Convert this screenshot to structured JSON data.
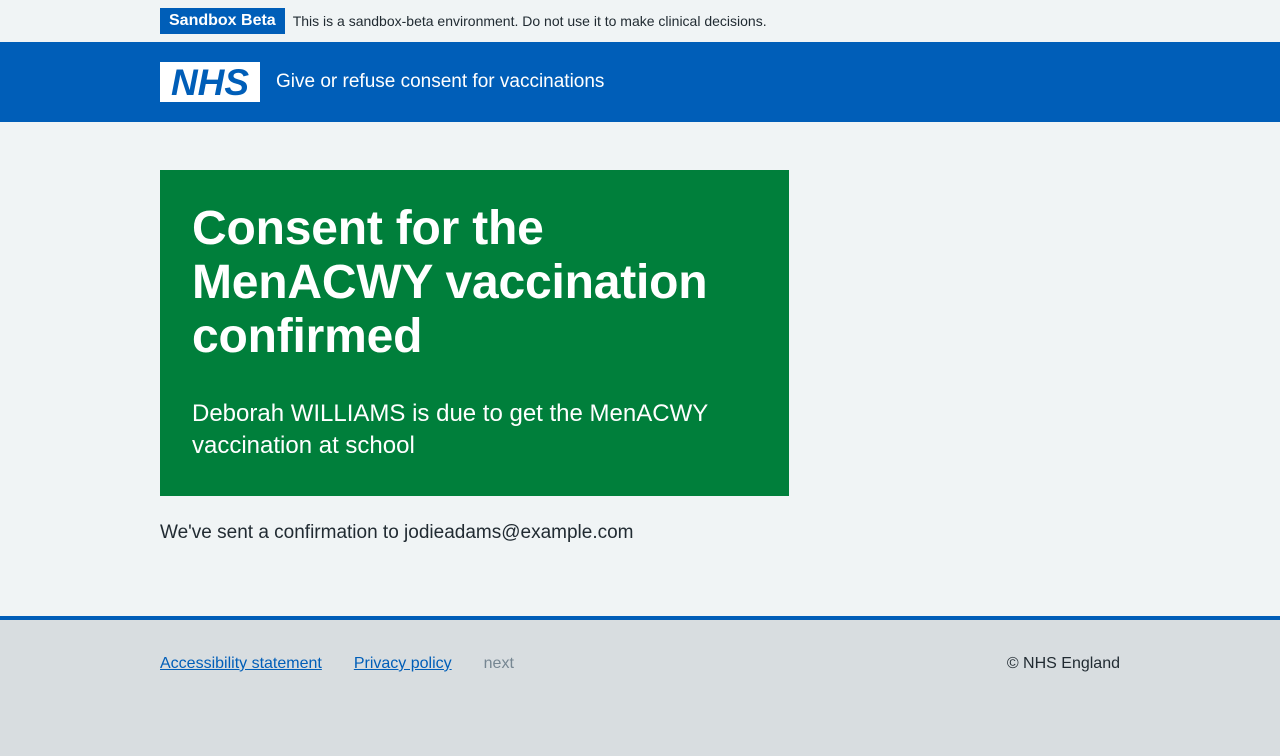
{
  "env_banner": {
    "tag": "Sandbox Beta",
    "message": "This is a sandbox-beta environment. Do not use it to make clinical decisions."
  },
  "header": {
    "logo_text": "NHS",
    "service_name": "Give or refuse consent for vaccinations"
  },
  "panel": {
    "title": "Consent for the MenACWY vaccination confirmed",
    "body": "Deborah WILLIAMS is due to get the MenACWY vaccination at school"
  },
  "main": {
    "confirmation": "We've sent a confirmation to jodieadams@example.com"
  },
  "footer": {
    "links": [
      "Accessibility statement",
      "Privacy policy"
    ],
    "version": "next",
    "copyright": "© NHS England"
  },
  "colors": {
    "nhs_blue": "#005eb8",
    "success_green": "#007f3b",
    "page_bg": "#f0f4f5",
    "footer_bg": "#d8dde0"
  }
}
